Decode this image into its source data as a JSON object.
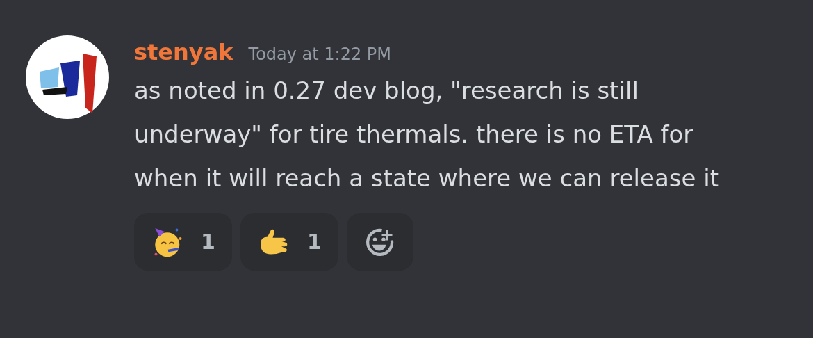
{
  "message": {
    "author": "stenyak",
    "timestamp": "Today at 1:22 PM",
    "text": "as noted in 0.27 dev blog, \"research is still underway\" for tire thermals. there is no ETA for when it will reach a state where we can release it"
  },
  "reactions": [
    {
      "kind": "party",
      "count": "1",
      "selected": false
    },
    {
      "kind": "hand",
      "count": "1",
      "selected": false
    },
    {
      "kind": "add"
    }
  ]
}
